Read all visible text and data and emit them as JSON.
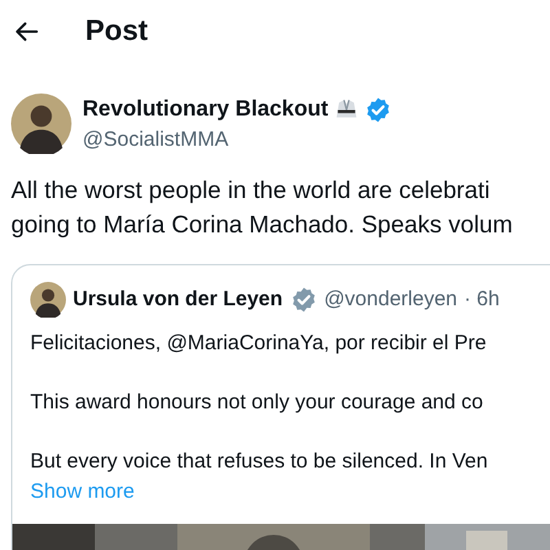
{
  "header": {
    "title": "Post"
  },
  "post": {
    "author": {
      "name": "Revolutionary Blackout",
      "handle": "@SocialistMMA",
      "badge": {
        "color": "#1d9bf0"
      }
    },
    "lines": [
      "All the worst people in the world are celebrati",
      "going to María Corina Machado. Speaks volum"
    ],
    "quote": {
      "author": {
        "name": "Ursula von der Leyen",
        "handle": "@vonderleyen",
        "time": "· 6h",
        "badge": {
          "color": "#829aab"
        }
      },
      "paragraphs": [
        "Felicitaciones, @MariaCorinaYa, por recibir el Pre",
        "This award honours not only your courage and co",
        "But every voice that refuses to be silenced. In Ven"
      ],
      "show_more": "Show more"
    }
  }
}
